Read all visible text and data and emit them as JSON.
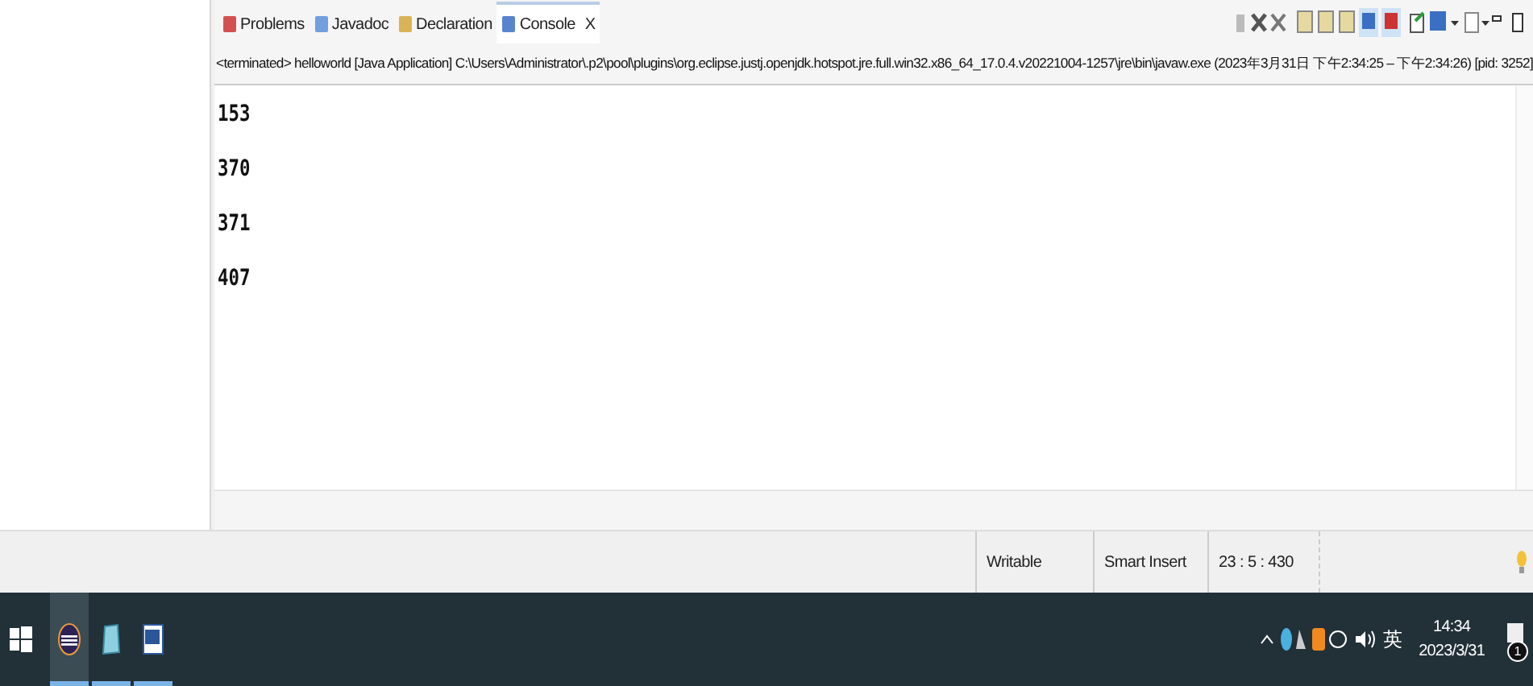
{
  "tabs": [
    {
      "label": "Problems",
      "kind": "problems",
      "selected": false
    },
    {
      "label": "Javadoc",
      "kind": "javadoc",
      "selected": false
    },
    {
      "label": "Declaration",
      "kind": "declaration",
      "selected": false
    },
    {
      "label": "Console",
      "kind": "console",
      "selected": true,
      "close": "X"
    }
  ],
  "console": {
    "header": "<terminated> helloworld [Java Application] C:\\Users\\Administrator\\.p2\\pool\\plugins\\org.eclipse.justj.openjdk.hotspot.jre.full.win32.x86_64_17.0.4.v20221004-1257\\jre\\bin\\javaw.exe  (2023年3月31日 下午2:34:25 – 下午2:34:26) [pid: 3252]",
    "lines": [
      "153",
      "370",
      "371",
      "407"
    ]
  },
  "status_bar": {
    "fields": [
      "Writable",
      "Smart Insert",
      "23 : 5 : 430"
    ]
  },
  "taskbar": {
    "apps": [
      {
        "kind": "eclipse",
        "selected": true
      },
      {
        "kind": "notepad",
        "selected": false
      },
      {
        "kind": "word",
        "selected": false
      }
    ],
    "ime": "英",
    "time": "14:34",
    "date": "2023/3/31",
    "notification_count": "1"
  }
}
